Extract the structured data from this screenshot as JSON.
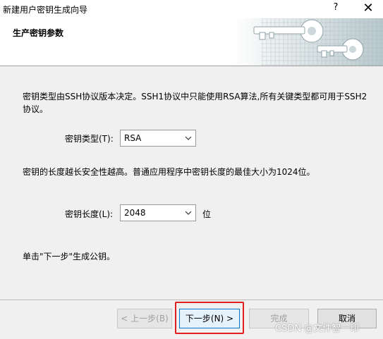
{
  "window": {
    "title": "新建用户密钥生成向导",
    "help": "?",
    "close": "✕"
  },
  "header": {
    "heading": "生产密钥参数"
  },
  "content": {
    "intro": "密钥类型由SSH协议版本决定。SSH1协议中只能使用RSA算法,所有关键类型都可用于SSH2协议。",
    "key_type_label": "密钥类型(T):",
    "key_type_value": "RSA",
    "length_note": "密钥的长度越长安全性越高。普通应用程序中密钥长度的最佳大小为1024位。",
    "key_length_label": "密钥长度(L):",
    "key_length_value": "2048",
    "key_length_unit": "位",
    "instruction": "单击\"下一步\"生成公钥。"
  },
  "buttons": {
    "back": "< 上一步(B)",
    "next": "下一步(N) >",
    "finish": "完成",
    "cancel": "取消"
  },
  "watermark": "CSDN @文件智一印",
  "colors": {
    "highlight": "#e02020",
    "accent": "#0078d7"
  }
}
